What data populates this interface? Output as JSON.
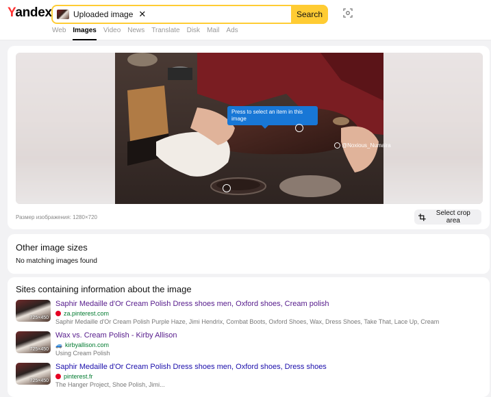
{
  "header": {
    "logo": {
      "first": "Y",
      "rest": "andex"
    },
    "search": {
      "chip_label": "Uploaded image",
      "clear_glyph": "✕",
      "button_label": "Search"
    },
    "tabs": [
      {
        "label": "Web",
        "active": false
      },
      {
        "label": "Images",
        "active": true
      },
      {
        "label": "Video",
        "active": false
      },
      {
        "label": "News",
        "active": false
      },
      {
        "label": "Translate",
        "active": false
      },
      {
        "label": "Disk",
        "active": false
      },
      {
        "label": "Mail",
        "active": false
      },
      {
        "label": "Ads",
        "active": false
      }
    ]
  },
  "viewer": {
    "tooltip": "Press to select an item in this image",
    "watermark": "@Noxious_Numaira",
    "size_text": "Размер изображения: 1280×720",
    "crop_label": "Select crop area"
  },
  "other_sizes": {
    "title": "Other image sizes",
    "message": "No matching images found"
  },
  "sites": {
    "title": "Sites containing information about the image",
    "results": [
      {
        "title": "Saphir Medaille d'Or Cream Polish Dress shoes men, Oxford shoes, Cream polish",
        "domain": "za.pinterest.com",
        "favicon": "pinterest-icon",
        "description": "Saphir Medaille d'Or Cream Polish Purple Haze, Jimi Hendrix, Combat Boots, Oxford Shoes, Wax, Dress Shoes, Take That, Lace Up, Cream",
        "thumb_label": "725×450",
        "visited": true
      },
      {
        "title": "Wax vs. Cream Polish - Kirby Allison",
        "domain": "kirbyallison.com",
        "favicon": "car-icon",
        "description": "Using Cream Polish",
        "thumb_label": "725×450",
        "visited": true
      },
      {
        "title": "Saphir Medaille d'Or Cream Polish Dress shoes men, Oxford shoes, Dress shoes",
        "domain": "pinterest.fr",
        "favicon": "pinterest-icon",
        "description": "The Hanger Project, Shoe Polish, Jimi...",
        "thumb_label": "725×450",
        "visited": false
      }
    ]
  },
  "colors": {
    "accent": "#ffcc33",
    "link": "#1a0dab",
    "visited": "#551a8b",
    "domain": "#007a2f",
    "tooltip": "#1877d6"
  }
}
